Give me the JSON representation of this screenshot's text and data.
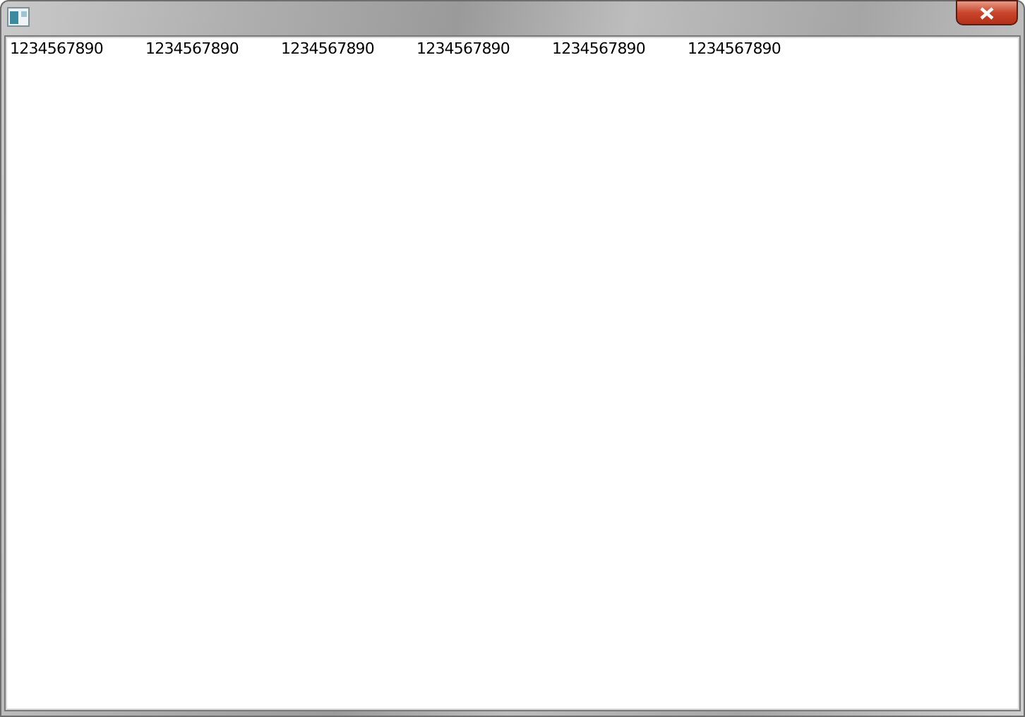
{
  "text_area": {
    "items": [
      "1234567890",
      "1234567890",
      "1234567890",
      "1234567890",
      "1234567890",
      "1234567890"
    ]
  }
}
